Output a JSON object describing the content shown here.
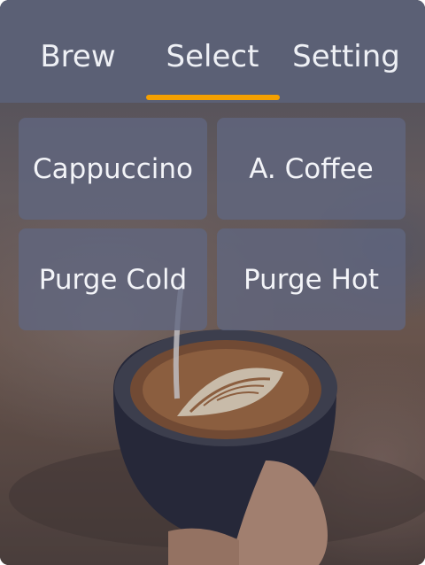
{
  "tabs": [
    {
      "label": "Brew",
      "active": false
    },
    {
      "label": "Select",
      "active": true
    },
    {
      "label": "Setting",
      "active": false
    }
  ],
  "buttons": [
    {
      "label": "Cappuccino"
    },
    {
      "label": "A. Coffee"
    },
    {
      "label": "Purge Cold"
    },
    {
      "label": "Purge Hot"
    }
  ],
  "background": {
    "icon": "latte-art-cup-image"
  },
  "colors": {
    "topbar": "#5b6075",
    "accent": "#f5a000",
    "tile": "#606680",
    "text": "#f3f4f8"
  }
}
